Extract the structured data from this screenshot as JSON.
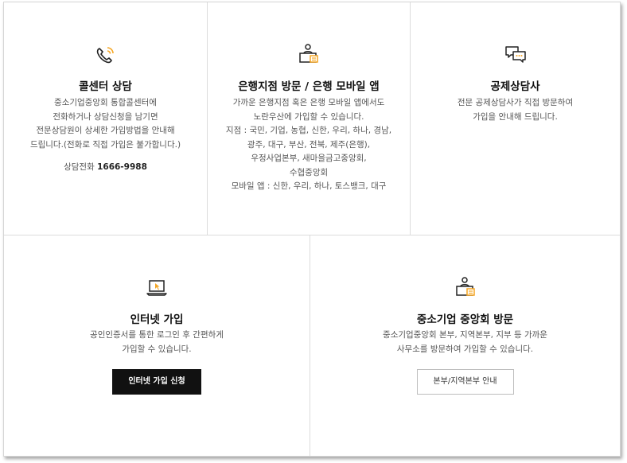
{
  "colors": {
    "accent": "#f5a623",
    "dark": "#111111",
    "border": "#dcdcdc"
  },
  "call_center": {
    "icon": "phone-icon",
    "title": "콜센터 상담",
    "desc": [
      "중소기업중앙회 통합콜센터에",
      "전화하거나 상담신청을 남기면",
      "전문상담원이 상세한 가입방법을 안내해",
      "드립니다.(전화로 직접 가입은 불가합니다.)"
    ],
    "phone_label": "상담전화",
    "phone_number": "1666-9988"
  },
  "bank_visit": {
    "icon": "bank-counter-icon",
    "title": "은행지점 방문 / 은행 모바일 앱",
    "desc": [
      "가까운 은행지점 혹은 은행 모바일 앱에서도",
      "노란우산에 가입할 수 있습니다.",
      "지점 : 국민, 기업, 농협, 신한, 우리, 하나, 경남,",
      "광주, 대구, 부산, 전북, 제주(은행),",
      "우정사업본부, 새마을금고중앙회,",
      "수협중앙회",
      "모바일 앱 : 신한, 우리, 하나, 토스뱅크, 대구"
    ]
  },
  "consultant": {
    "icon": "chat-bubbles-icon",
    "title": "공제상담사",
    "desc": [
      "전문 공제상담사가 직접 방문하여",
      "가입을 안내해 드립니다."
    ]
  },
  "internet": {
    "icon": "laptop-icon",
    "title": "인터넷 가입",
    "desc": [
      "공인인증서를 통한 로그인 후 간편하게",
      "가입할 수 있습니다."
    ],
    "button": "인터넷 가입 신청"
  },
  "hq_visit": {
    "icon": "office-desk-icon",
    "title": "중소기업 중앙회 방문",
    "desc": [
      "중소기업중앙회 본부, 지역본부, 지부 등 가까운",
      "사무소를 방문하여 가입할 수 있습니다."
    ],
    "button": "본부/지역본부 안내"
  }
}
